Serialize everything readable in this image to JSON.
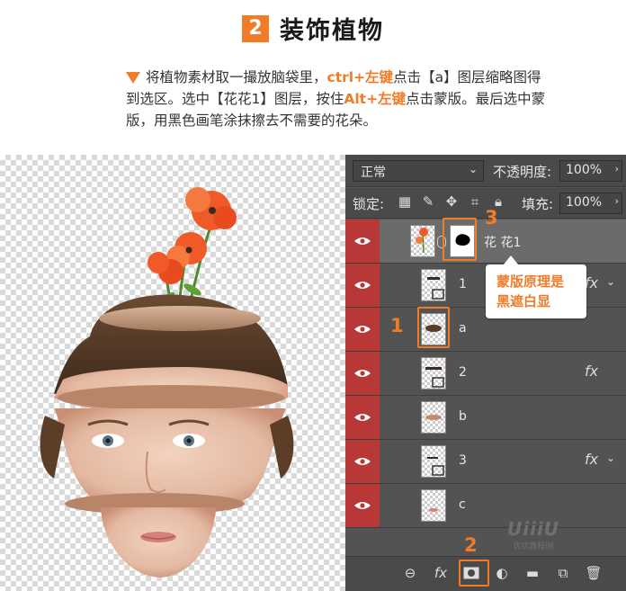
{
  "header": {
    "step_number": "2",
    "title": "装饰植物",
    "instruction_part1": "将植物素材取一撮放脑袋里，",
    "instruction_key1": "ctrl+左键",
    "instruction_part2": "点击【a】图层缩略图得到选区。选中【花花1】图层，按住",
    "instruction_key2": "Alt+左键",
    "instruction_part3": "点击蒙版。最后选中蒙版，用黑色画笔涂抹擦去不需要的花朵。"
  },
  "panel": {
    "blend_mode": "正常",
    "opacity_label": "不透明度:",
    "opacity_value": "100%",
    "lock_label": "锁定:",
    "fill_label": "填充:",
    "fill_value": "100%",
    "layers": [
      {
        "name": "花 花1",
        "has_fx": false,
        "selected": true
      },
      {
        "name": "1",
        "has_fx": true,
        "selected": false
      },
      {
        "name": "a",
        "has_fx": false,
        "selected": false
      },
      {
        "name": "2",
        "has_fx": true,
        "selected": false
      },
      {
        "name": "b",
        "has_fx": false,
        "selected": false
      },
      {
        "name": "3",
        "has_fx": true,
        "selected": false
      },
      {
        "name": "c",
        "has_fx": false,
        "selected": false
      }
    ],
    "fx_label": "fx"
  },
  "annotations": {
    "marker1": "1",
    "marker2": "2",
    "marker3": "3",
    "callout_line1": "蒙版原理是",
    "callout_line2": "黑遮白显"
  },
  "watermark": {
    "logo": "UiiiU",
    "sub": "优优教程网"
  },
  "colors": {
    "accent": "#f07c28",
    "panel_bg": "#535353",
    "eye_red": "#b83838"
  }
}
